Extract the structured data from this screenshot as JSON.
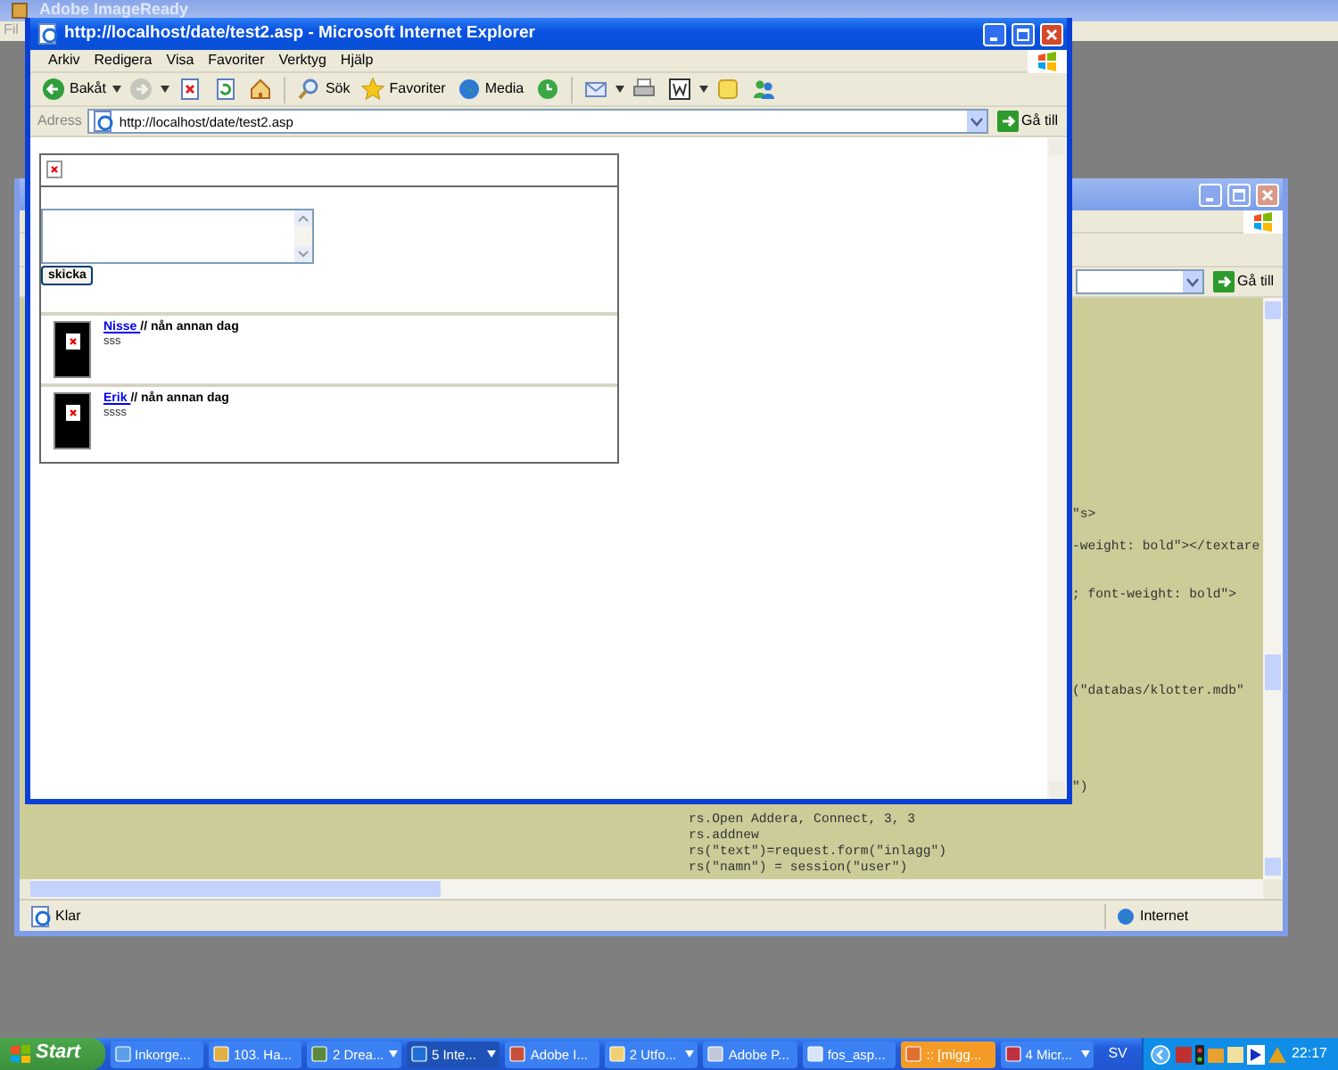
{
  "desktop_window": {
    "title": "Adobe ImageReady",
    "menu": [
      "Fil"
    ]
  },
  "code_window": {
    "go_button": "Gå till",
    "code_lines": [
      {
        "text": "\"s>",
        "kind": "partial"
      },
      {
        "text": "-weight: bold\"></textare",
        "kind": "partial"
      },
      {
        "text": "; font-weight: bold\">",
        "kind": "partial"
      },
      {
        "text": "(\"databas/klotter.mdb\"",
        "kind": "partial"
      },
      {
        "text": "\")",
        "kind": "partial"
      },
      {
        "text": "rs.Open Addera, Connect, 3, 3",
        "kind": "full"
      },
      {
        "text": "rs.addnew",
        "kind": "full"
      },
      {
        "text": "rs(\"text\")=request.form(\"inlagg\")",
        "kind": "full"
      },
      {
        "text": "rs(\"namn\") = session(\"user\")",
        "kind": "full"
      }
    ],
    "status": "Klar",
    "zone": "Internet"
  },
  "browser": {
    "title": "http://localhost/date/test2.asp - Microsoft Internet Explorer",
    "menu": [
      "Arkiv",
      "Redigera",
      "Visa",
      "Favoriter",
      "Verktyg",
      "Hjälp"
    ],
    "toolbar": [
      {
        "kind": "back",
        "label": "Bakåt",
        "disabled": false
      },
      {
        "kind": "forward",
        "disabled": true
      },
      {
        "kind": "stop",
        "disabled": false
      },
      {
        "kind": "refresh",
        "disabled": false
      },
      {
        "kind": "home",
        "disabled": false
      },
      {
        "kind": "search",
        "label": "Sök",
        "disabled": false
      },
      {
        "kind": "favorites",
        "label": "Favoriter",
        "disabled": false
      },
      {
        "kind": "media",
        "label": "Media",
        "disabled": false
      },
      {
        "kind": "history",
        "disabled": false
      },
      {
        "kind": "mail",
        "disabled": false
      },
      {
        "kind": "print",
        "disabled": false
      },
      {
        "kind": "edit",
        "disabled": false
      },
      {
        "kind": "discuss",
        "disabled": false
      },
      {
        "kind": "messenger",
        "disabled": false
      }
    ],
    "address_label": "Adress",
    "address": "http://localhost/date/test2.asp",
    "go_button": "Gå till",
    "page": {
      "submit_button": "skicka",
      "posts": [
        {
          "author": "Nisse ",
          "meta": "// nån annan dag",
          "text": "sss"
        },
        {
          "author": "Erik ",
          "meta": "// nån annan dag",
          "text": "ssss"
        }
      ]
    }
  },
  "taskbar": {
    "start": "Start",
    "tasks": [
      {
        "label": "Inkorge...",
        "selected": false,
        "grouped": false,
        "flashing": false
      },
      {
        "label": "103. Ha...",
        "selected": false,
        "grouped": false,
        "flashing": false
      },
      {
        "label": "2 Drea...",
        "selected": false,
        "grouped": true,
        "flashing": false
      },
      {
        "label": "5 Inte...",
        "selected": true,
        "grouped": true,
        "flashing": false
      },
      {
        "label": "Adobe I...",
        "selected": false,
        "grouped": false,
        "flashing": false
      },
      {
        "label": "2 Utfo...",
        "selected": false,
        "grouped": true,
        "flashing": false
      },
      {
        "label": "Adobe P...",
        "selected": false,
        "grouped": false,
        "flashing": false
      },
      {
        "label": "fos_asp...",
        "selected": false,
        "grouped": false,
        "flashing": false
      },
      {
        "label": ":: [migg...",
        "selected": false,
        "grouped": false,
        "flashing": true
      },
      {
        "label": "4 Micr...",
        "selected": false,
        "grouped": true,
        "flashing": false
      }
    ],
    "language": "SV",
    "clock": "22:17"
  }
}
